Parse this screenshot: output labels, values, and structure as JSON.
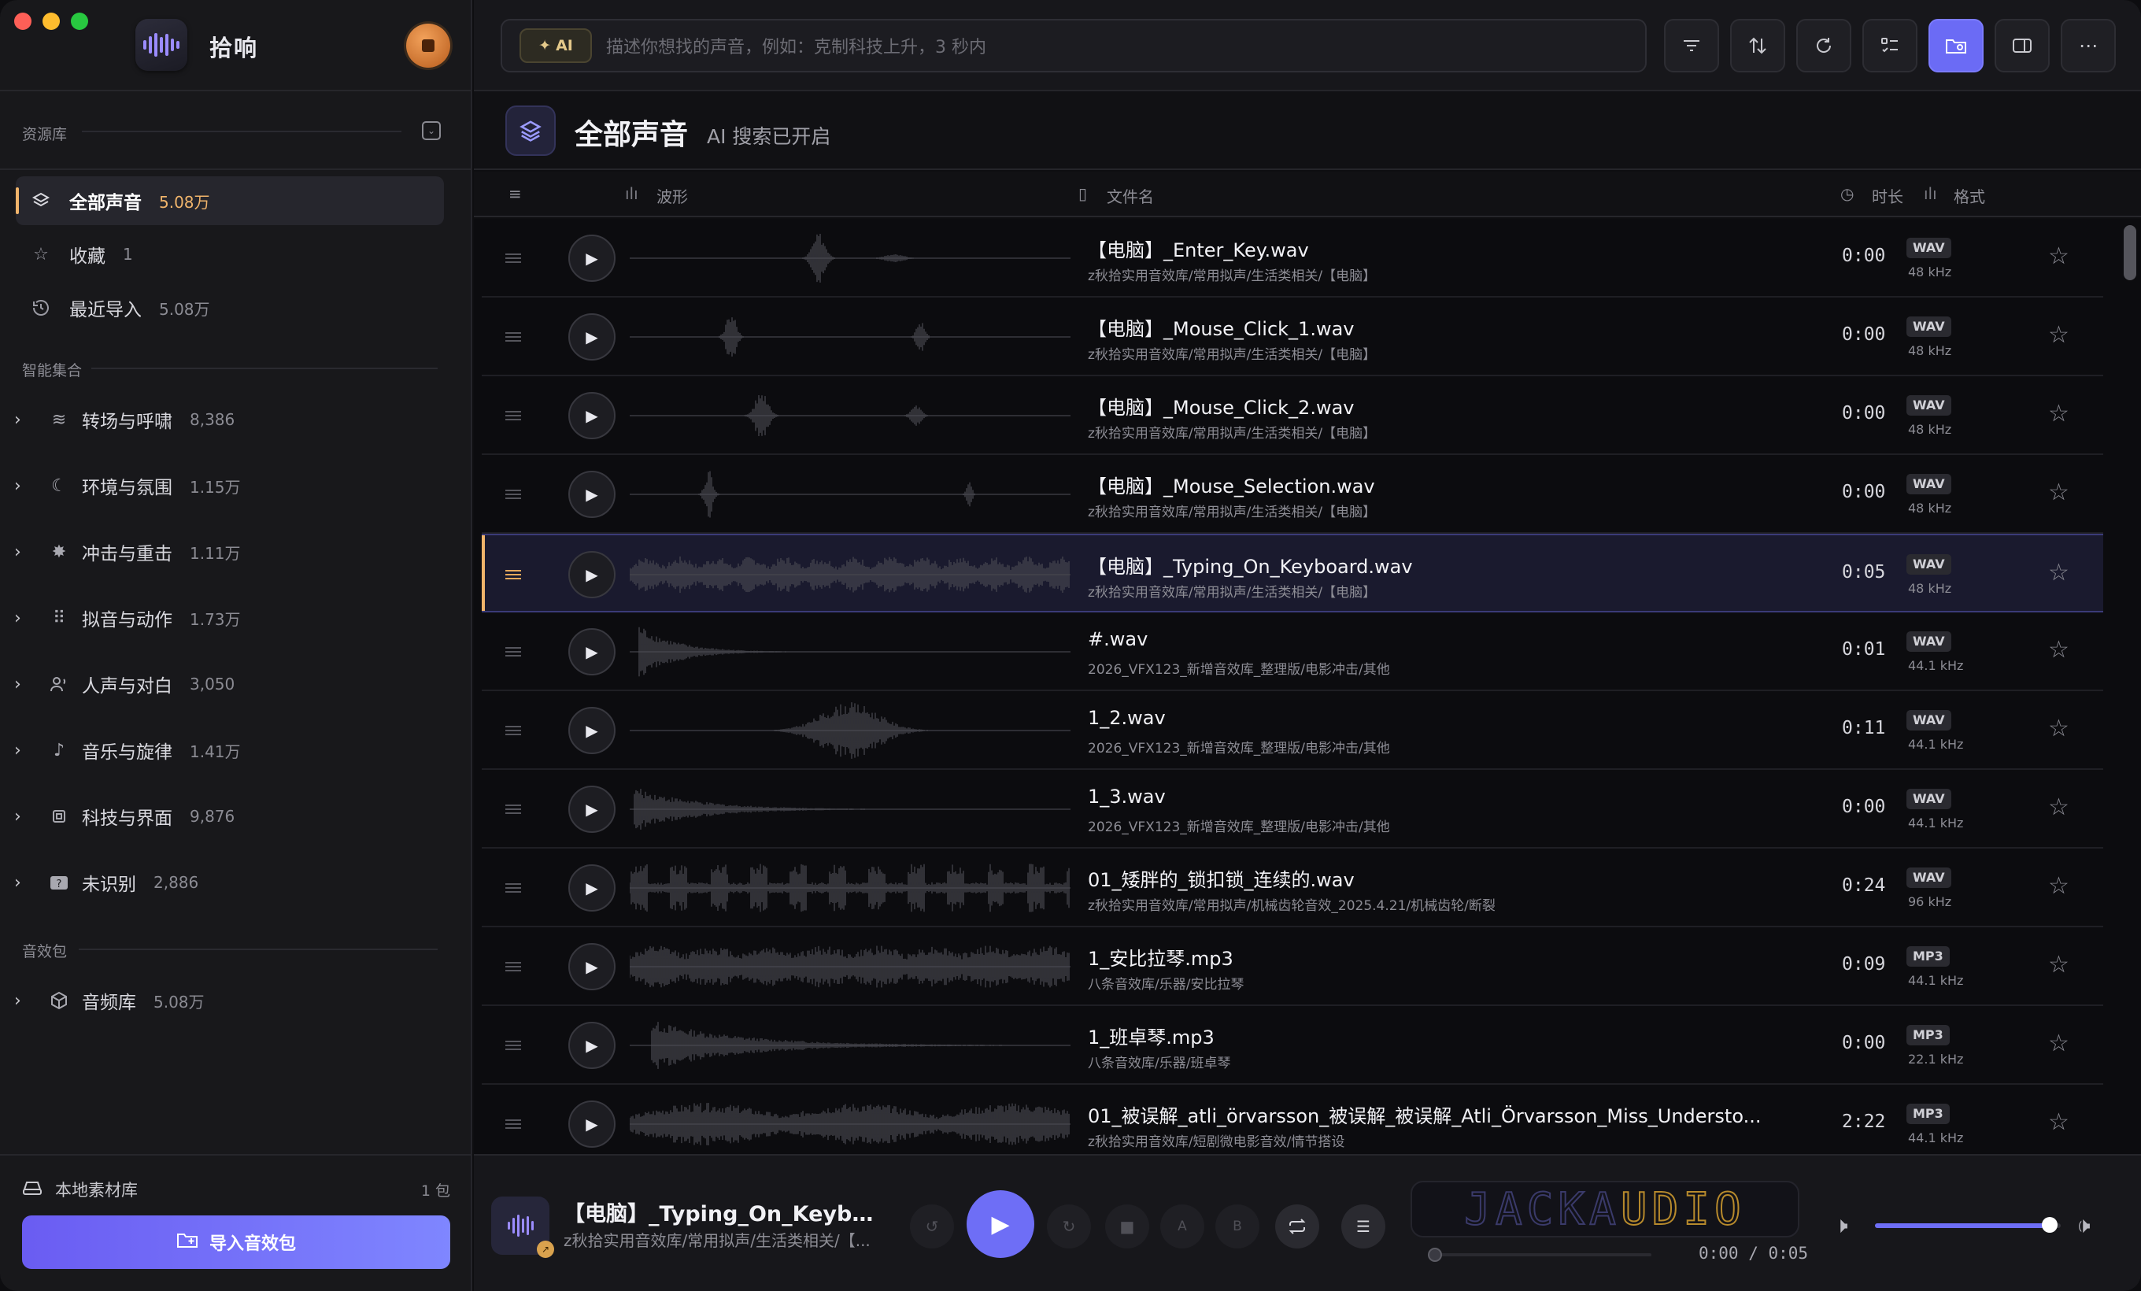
{
  "app": {
    "title": "拾响"
  },
  "sidebar": {
    "library_header": "资源库",
    "items": [
      {
        "label": "全部声音",
        "count": "5.08万",
        "icon": "layers-icon"
      },
      {
        "label": "收藏",
        "count": "1",
        "icon": "star-icon"
      },
      {
        "label": "最近导入",
        "count": "5.08万",
        "icon": "history-icon"
      }
    ],
    "smart_header": "智能集合",
    "smart": [
      {
        "label": "转场与呼啸",
        "count": "8,386",
        "icon": "wind-icon"
      },
      {
        "label": "环境与氛围",
        "count": "1.15万",
        "icon": "moon-icon"
      },
      {
        "label": "冲击与重击",
        "count": "1.11万",
        "icon": "burst-icon"
      },
      {
        "label": "拟音与动作",
        "count": "1.73万",
        "icon": "footprints-icon"
      },
      {
        "label": "人声与对白",
        "count": "3,050",
        "icon": "speaker-person-icon"
      },
      {
        "label": "音乐与旋律",
        "count": "1.41万",
        "icon": "music-note-icon"
      },
      {
        "label": "科技与界面",
        "count": "9,876",
        "icon": "chip-icon"
      },
      {
        "label": "未识别",
        "count": "2,886",
        "icon": "unknown-icon"
      }
    ],
    "pack_header": "音效包",
    "packs": [
      {
        "label": "音频库",
        "count": "5.08万",
        "icon": "box-icon"
      }
    ],
    "local_library": {
      "label": "本地素材库",
      "count": "1 包"
    },
    "import_button": "导入音效包"
  },
  "search": {
    "ai_label": "AI",
    "placeholder": "描述你想找的声音，例如：克制科技上升，3 秒内"
  },
  "header": {
    "title": "全部声音",
    "subtitle": "AI 搜索已开启"
  },
  "columns": {
    "waveform": "波形",
    "filename": "文件名",
    "duration": "时长",
    "format": "格式"
  },
  "rows": [
    {
      "name": "【电脑】_Enter_Key.wav",
      "path": "z秋拾实用音效库/常用拟声/生活类相关/【电脑】",
      "duration": "0:00",
      "format": "WAV",
      "rate": "48 kHz"
    },
    {
      "name": "【电脑】_Mouse_Click_1.wav",
      "path": "z秋拾实用音效库/常用拟声/生活类相关/【电脑】",
      "duration": "0:00",
      "format": "WAV",
      "rate": "48 kHz"
    },
    {
      "name": "【电脑】_Mouse_Click_2.wav",
      "path": "z秋拾实用音效库/常用拟声/生活类相关/【电脑】",
      "duration": "0:00",
      "format": "WAV",
      "rate": "48 kHz"
    },
    {
      "name": "【电脑】_Mouse_Selection.wav",
      "path": "z秋拾实用音效库/常用拟声/生活类相关/【电脑】",
      "duration": "0:00",
      "format": "WAV",
      "rate": "48 kHz"
    },
    {
      "name": "【电脑】_Typing_On_Keyboard.wav",
      "path": "z秋拾实用音效库/常用拟声/生活类相关/【电脑】",
      "duration": "0:05",
      "format": "WAV",
      "rate": "48 kHz"
    },
    {
      "name": "#.wav",
      "path": "2026_VFX123_新增音效库_整理版/电影冲击/其他",
      "duration": "0:01",
      "format": "WAV",
      "rate": "44.1 kHz"
    },
    {
      "name": "1_2.wav",
      "path": "2026_VFX123_新增音效库_整理版/电影冲击/其他",
      "duration": "0:11",
      "format": "WAV",
      "rate": "44.1 kHz"
    },
    {
      "name": "1_3.wav",
      "path": "2026_VFX123_新增音效库_整理版/电影冲击/其他",
      "duration": "0:00",
      "format": "WAV",
      "rate": "44.1 kHz"
    },
    {
      "name": "01_矮胖的_锁扣锁_连续的.wav",
      "path": "z秋拾实用音效库/常用拟声/机械齿轮音效_2025.4.21/机械齿轮/断裂",
      "duration": "0:24",
      "format": "WAV",
      "rate": "96 kHz"
    },
    {
      "name": "1_安比拉琴.mp3",
      "path": "八条音效库/乐器/安比拉琴",
      "duration": "0:09",
      "format": "MP3",
      "rate": "44.1 kHz"
    },
    {
      "name": "1_班卓琴.mp3",
      "path": "八条音效库/乐器/班卓琴",
      "duration": "0:00",
      "format": "MP3",
      "rate": "22.1 kHz"
    },
    {
      "name": "01_被误解_atli_örvarsson_被误解_被误解_Atli_Örvarsson_Miss_Understo...",
      "path": "z秋拾实用音效库/短剧微电影音效/情节搭设",
      "duration": "2:22",
      "format": "MP3",
      "rate": "44.1 kHz"
    }
  ],
  "player": {
    "title": "【电脑】_Typing_On_Keyboard....",
    "path": "z秋拾实用音效库/常用拟声/生活类相关/【...",
    "ab_a": "A",
    "ab_b": "B",
    "display": "JACKAUDIO",
    "time": "0:00 / 0:05",
    "volume": 0.94,
    "progress": 0
  },
  "colors": {
    "accent": "#6e6ef6",
    "highlight": "#f0b46b"
  }
}
